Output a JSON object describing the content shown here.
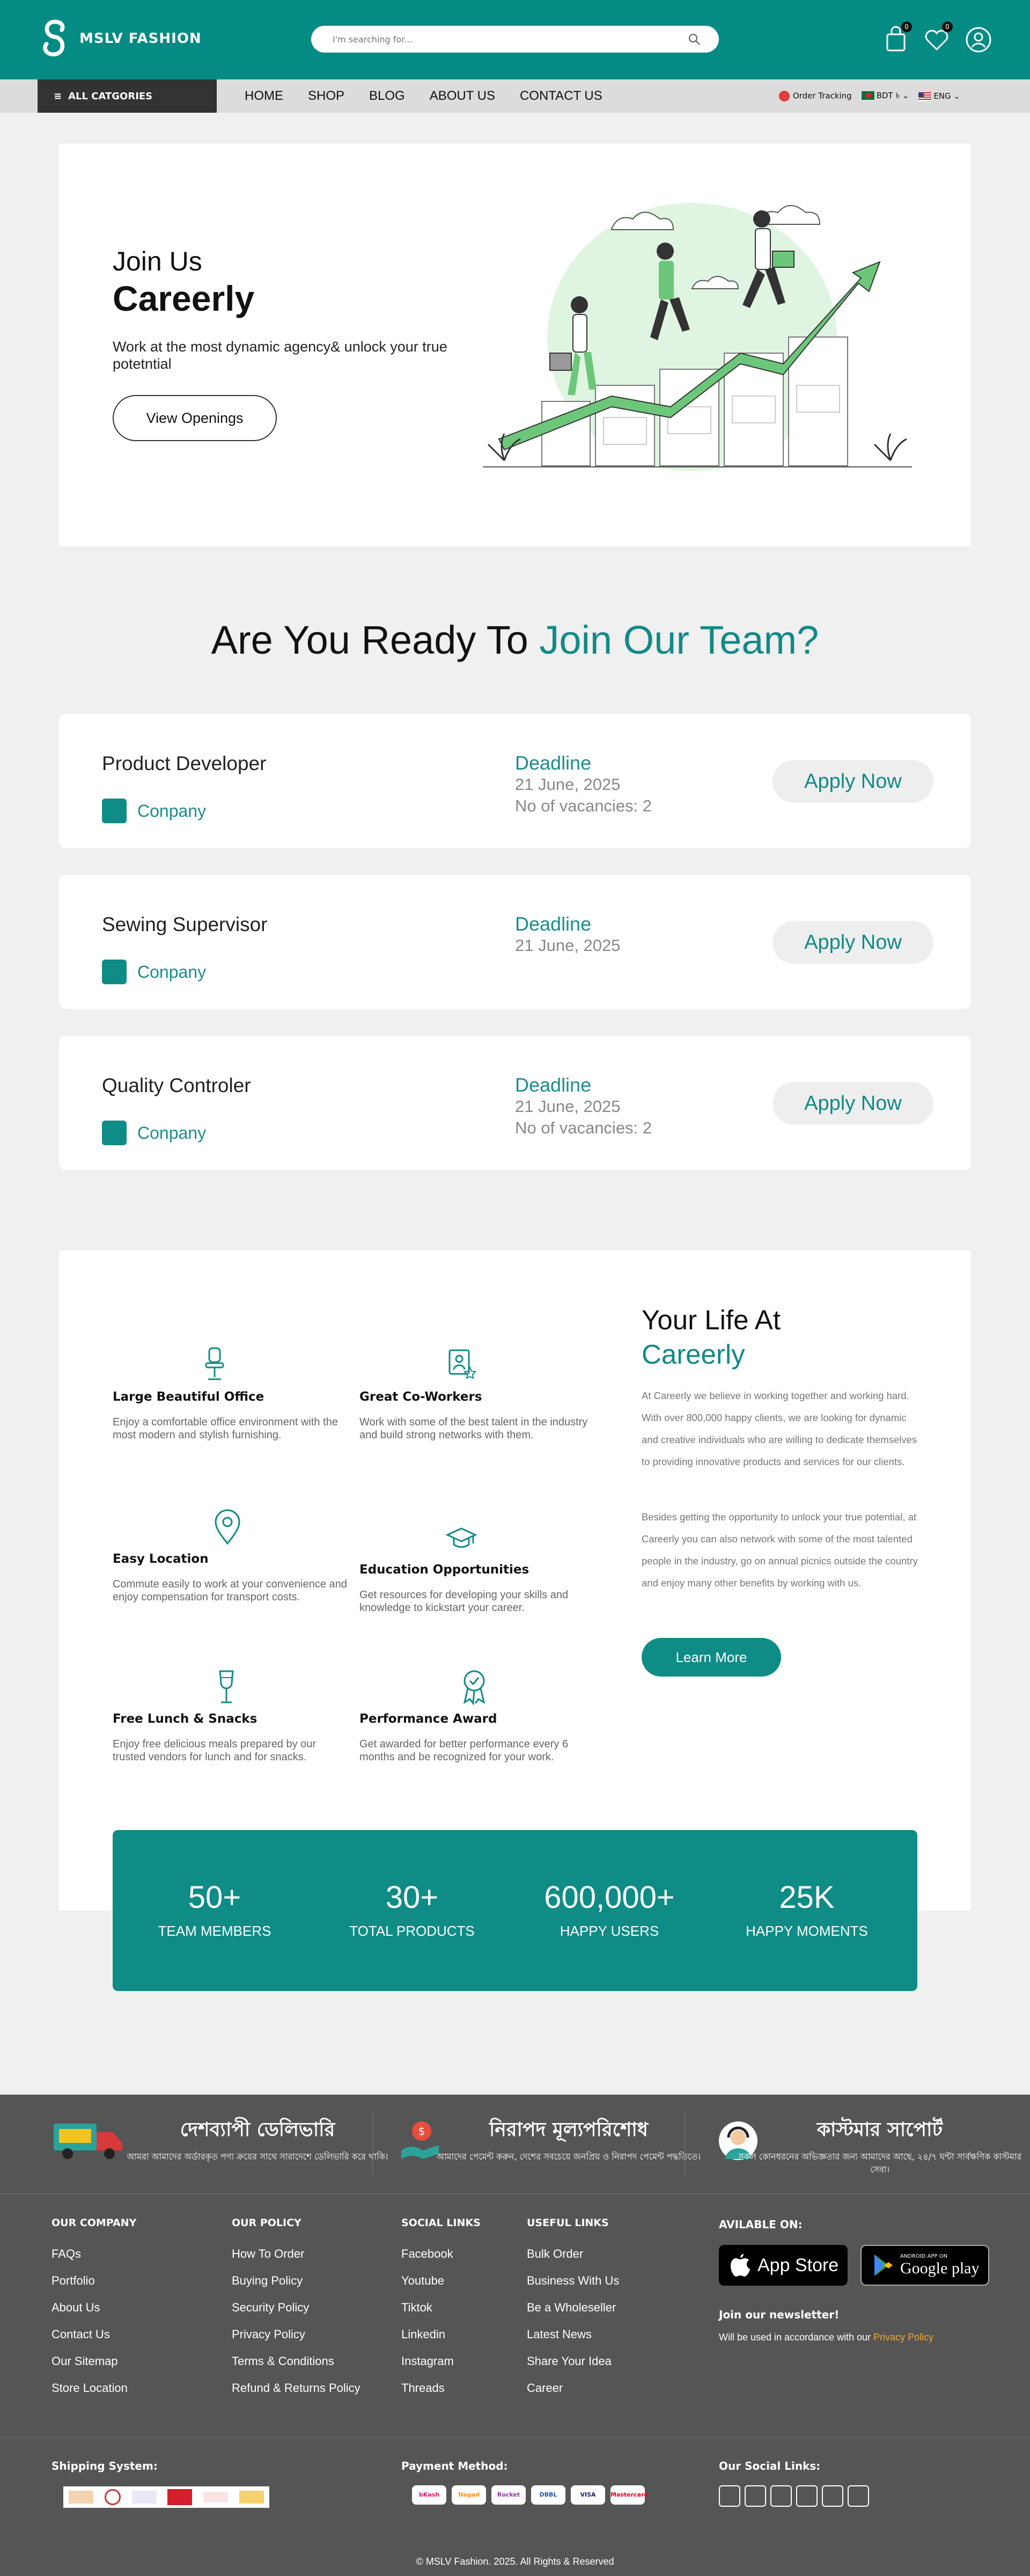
{
  "header": {
    "logo_text": "MSLV FASHION",
    "search_placeholder": "I'm searching for...",
    "cart_count": "0",
    "wishlist_count": "0"
  },
  "nav": {
    "categories_label": "ALL CATGORIES",
    "items": [
      "HOME",
      "SHOP",
      "BLOG",
      "ABOUT US",
      "CONTACT US"
    ],
    "order_tracking": "Order Tracking",
    "currency": "BDT ৳",
    "language": "ENG"
  },
  "hero": {
    "join": "Join Us",
    "brand": "Careerly",
    "description": "Work at the most dynamic agency& unlock your true potetntial",
    "button": "View Openings"
  },
  "section": {
    "title_plain": "Are You Ready To ",
    "title_accent": "Join Our Team?"
  },
  "jobs": [
    {
      "title": "Product Developer",
      "company": "Conpany",
      "deadline_label": "Deadline",
      "deadline": "21 June, 2025",
      "vacancies": "No of vacancies: 2",
      "apply": "Apply Now"
    },
    {
      "title": "Sewing Supervisor",
      "company": "Conpany",
      "deadline_label": "Deadline",
      "deadline": "21 June, 2025",
      "vacancies": "",
      "apply": "Apply Now"
    },
    {
      "title": "Quality Controler",
      "company": "Conpany",
      "deadline_label": "Deadline",
      "deadline": "21 June, 2025",
      "vacancies": "No of vacancies: 2",
      "apply": "Apply Now"
    }
  ],
  "life": {
    "title": "Your Life At",
    "title_accent": "Careerly",
    "p1": "At Careerly we believe in working together and working hard. With over 800,000 happy clients, we are looking for dynamic and creative individuals who are willing to dedicate themselves to providing innovative products and services for our clients.",
    "p2": "Besides getting the opportunity to unlock your true potential, at Careerly you can also network with some of the most talented people in the industry, go on annual picnics outside the country and enjoy many other benefits by working with us.",
    "button": "Learn More",
    "features": [
      {
        "name": "Large Beautiful Office",
        "desc": "Enjoy a comfortable office environment with the most modern and stylish furnishing.",
        "icon": "chair-icon"
      },
      {
        "name": "Great Co-Workers",
        "desc": "Work with some of the best talent in the industry and build strong networks with them.",
        "icon": "coworker-icon"
      },
      {
        "name": "Easy Location",
        "desc": "Commute easily to work at your convenience and enjoy compensation for transport costs.",
        "icon": "location-icon"
      },
      {
        "name": "Education Opportunities",
        "desc": "Get resources for developing your skills and knowledge to kickstart your career.",
        "icon": "graduation-icon"
      },
      {
        "name": "Free Lunch & Snacks",
        "desc": "Enjoy free delicious meals prepared by our trusted vendors for lunch and for snacks.",
        "icon": "wine-glass-icon"
      },
      {
        "name": "Performance Award",
        "desc": "Get awarded for better performance every 6 months and be recognized for your work.",
        "icon": "award-icon"
      }
    ]
  },
  "stats": [
    {
      "num": "50+",
      "label": "TEAM MEMBERS"
    },
    {
      "num": "30+",
      "label": "TOTAL PRODUCTS"
    },
    {
      "num": "600,000+",
      "label": "HAPPY USERS"
    },
    {
      "num": "25K",
      "label": "HAPPY MOMENTS"
    }
  ],
  "footer": {
    "features": [
      {
        "title": "দেশব্যাপী ডেলিভারি",
        "sub": "আমরা আমাদের অর্ডারকৃত পণ্য ক্রয়ের সাথে সারাদেশে ডেলিভারি করে থাকি।",
        "icon": "delivery-truck-icon"
      },
      {
        "title": "নিরাপদ মূল্যপরিশোধ",
        "sub": "আমাদের পেমেন্ট করুন, দেশের সবচেয়ে জনপ্রিয় ও নিরাপদ পেমেন্ট পদ্ধতিতে।",
        "icon": "secure-payment-icon"
      },
      {
        "title": "কাস্টমার সাপোর্ট",
        "sub": "সকল কোনধরনের অভিজ্ঞতার জন্য আমাদের আছে, ২৪/৭ ঘন্টা সার্বক্ষণিক কাস্টমার সেবা।",
        "icon": "customer-support-icon"
      }
    ],
    "company": {
      "heading": "OUR COMPANY",
      "items": [
        "FAQs",
        "Portfolio",
        "About Us",
        "Contact Us",
        "Our Sitemap",
        "Store Location"
      ]
    },
    "policy": {
      "heading": "OUR POLICY",
      "items": [
        "How To Order",
        "Buying Policy",
        "Security Policy",
        "Privacy Policy",
        "Terms & Conditions",
        "Refund & Returns Policy"
      ]
    },
    "social": {
      "heading": "SOCIAL LINKS",
      "items": [
        "Facebook",
        "Youtube",
        "Tiktok",
        "Linkedin",
        "Instagram",
        "Threads"
      ]
    },
    "useful": {
      "heading": "USEFUL LINKS",
      "items": [
        "Bulk Order",
        "Business With Us",
        "Be a Wholeseller",
        "Latest News",
        "Share Your Idea",
        "Career"
      ]
    },
    "available_on": "AVILABLE ON:",
    "app_store": "App Store",
    "google_play": "Google play",
    "google_play_small": "ANDROID APP ON",
    "newsletter_title": "Join our newsletter!",
    "newsletter_text": "Will be used in accordance with our ",
    "privacy_link": "Privacy Policy",
    "shipping_label": "Shipping System:",
    "payment_label": "Payment Method:",
    "payment_methods": [
      "bKash",
      "Nagad",
      "Rocket",
      "DBBL",
      "VISA",
      "Mastercard"
    ],
    "social_label": "Our Social Links:",
    "copyright": "© MSLV Fashion. 2025. All Rights & Reserved"
  },
  "colors": {
    "primary": "#0e8c85",
    "accent_text": "#128a87",
    "footer_bg": "#555555",
    "nav_bg": "#dcdcdc"
  }
}
